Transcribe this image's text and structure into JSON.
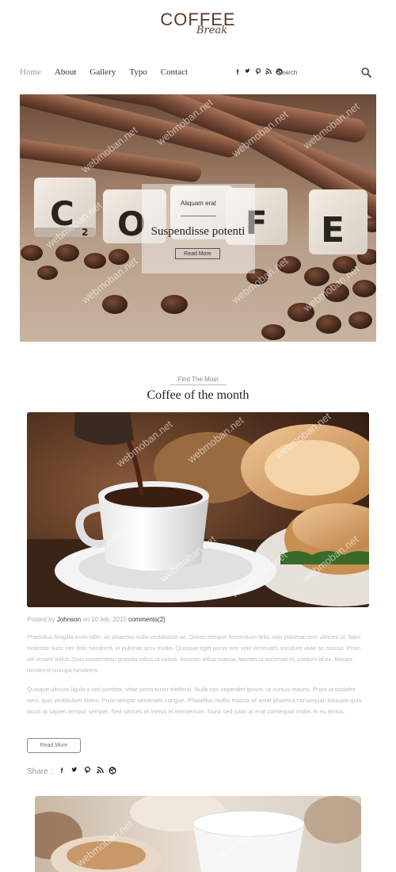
{
  "header": {
    "logo_main": "COFFEE",
    "logo_sub": "Break",
    "nav": [
      "Home",
      "About",
      "Gallery",
      "Typo",
      "Contact"
    ],
    "social_icons": [
      "facebook-icon",
      "twitter-icon",
      "pinterest-icon",
      "rss-icon",
      "dribbble-icon"
    ],
    "search_placeholder": "Search"
  },
  "hero": {
    "tag": "Aliquam erat",
    "title": "Suspendisse potenti",
    "button": "Read More",
    "tiles": [
      "C",
      "O",
      "F",
      "F",
      "E"
    ]
  },
  "section": {
    "kicker": "Find The Most",
    "title": "Coffee of the month"
  },
  "post": {
    "posted_by": "Posted by",
    "author": "Johnson",
    "on_text": "on 10 feb, 2015",
    "comments": "comments(2)",
    "para1": "Phasellus fringilla enim nibh, ac pharetra nulla vestibulum ac. Donec tempor fermentum felis, non placerat sem ultrices ut. Nam molestie nunc nec felis hendrerit, in pulvinar arcu mollis. Quisque eget purus nec velit venenatis tincidunt vitae ac massa. Proin vel ornare tellus. Duis consectetur gravida tellus ut varius. Aenean tellus massa, laoreet ut euismod et, pretium id ex. Mauris hendrerit suscipit hendrerit.",
    "para2": "Quisque ultrices ligula a nisl porttitor, vitae porta tortor eleifend. Nulla nec imperdiet ipsum, ut cursus mauris. Proin ut sodales sem, quis vestibulum libero. Proin tempor venenatis congue. Phasellus mollis massa sit amet pharetra consequat. Aliquam quis lacus at sapien tempor semper. Sed ultrices et metus et elementum. Nunc sed justo at erat consequat mollis et eu lectus.",
    "read_more": "Read More",
    "share_label": "Share :",
    "share_icons": [
      "facebook-icon",
      "twitter-icon",
      "pinterest-icon",
      "rss-icon",
      "dribbble-icon"
    ]
  },
  "watermark": "webmoban.net"
}
